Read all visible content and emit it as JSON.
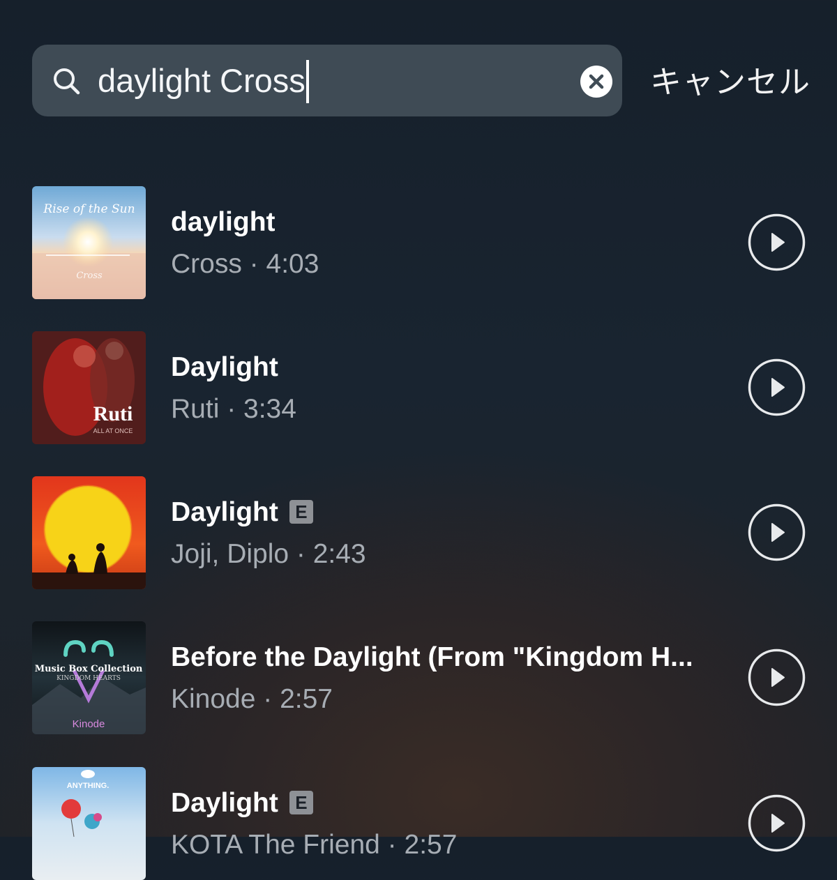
{
  "search": {
    "query": "daylight Cross",
    "cancel_label": "キャンセル"
  },
  "results": [
    {
      "title": "daylight",
      "subtitle": "Cross · 4:03",
      "explicit": false,
      "art_text": [
        "Rise of the Sun",
        "Cross"
      ]
    },
    {
      "title": "Daylight",
      "subtitle": "Ruti · 3:34",
      "explicit": false,
      "art_text": [
        "Ruti",
        "ALL AT ONCE"
      ]
    },
    {
      "title": "Daylight",
      "subtitle": "Joji, Diplo · 2:43",
      "explicit": true,
      "explicit_label": "E",
      "art_text": []
    },
    {
      "title": "Before the Daylight (From \"Kingdom H...",
      "subtitle": "Kinode · 2:57",
      "explicit": false,
      "art_text": [
        "Music Box Collection",
        "KINGDOM HEARTS",
        "Kinode"
      ]
    },
    {
      "title": "Daylight",
      "subtitle": "KOTA The Friend · 2:57",
      "explicit": true,
      "explicit_label": "E",
      "art_text": [
        "ANYTHING."
      ]
    }
  ]
}
